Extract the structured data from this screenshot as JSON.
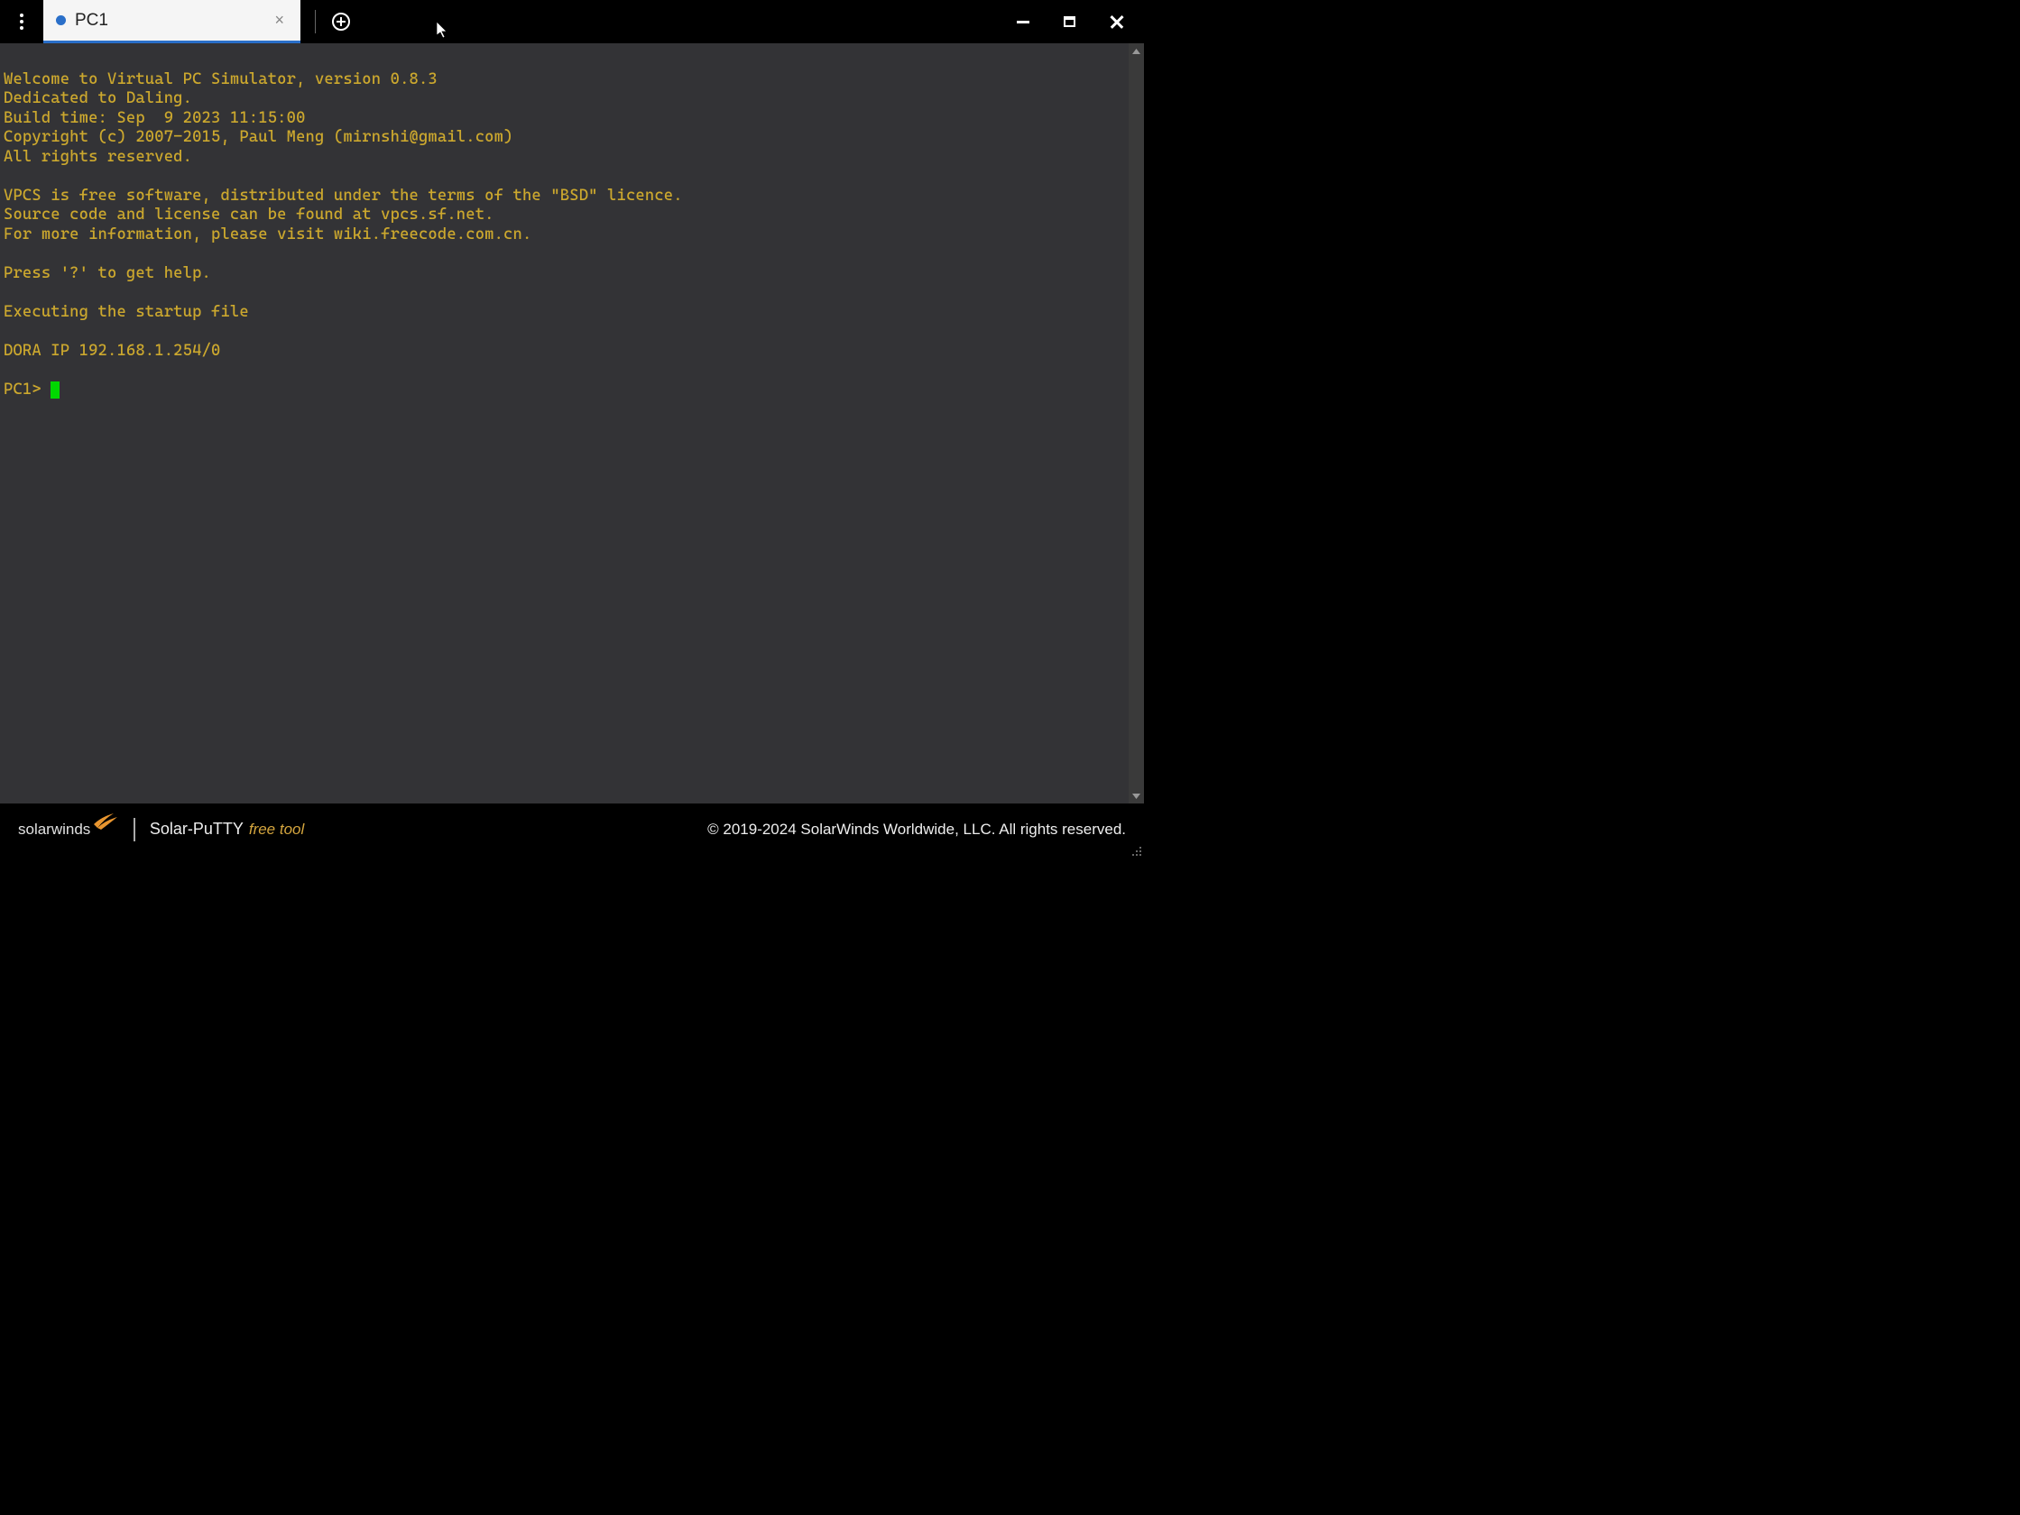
{
  "tab": {
    "label": "PC1"
  },
  "terminal": {
    "lines": [
      "",
      "Welcome to Virtual PC Simulator, version 0.8.3",
      "Dedicated to Daling.",
      "Build time: Sep  9 2023 11:15:00",
      "Copyright (c) 2007-2015, Paul Meng (mirnshi@gmail.com)",
      "All rights reserved.",
      "",
      "VPCS is free software, distributed under the terms of the \"BSD\" licence.",
      "Source code and license can be found at vpcs.sf.net.",
      "For more information, please visit wiki.freecode.com.cn.",
      "",
      "Press '?' to get help.",
      "",
      "Executing the startup file",
      "",
      "DORA IP 192.168.1.254/0",
      ""
    ],
    "prompt": "PC1> "
  },
  "footer": {
    "brand": "solarwinds",
    "product": "Solar-PuTTY",
    "free_label": "free tool",
    "copyright": "© 2019-2024 SolarWinds Worldwide, LLC. All rights reserved."
  }
}
